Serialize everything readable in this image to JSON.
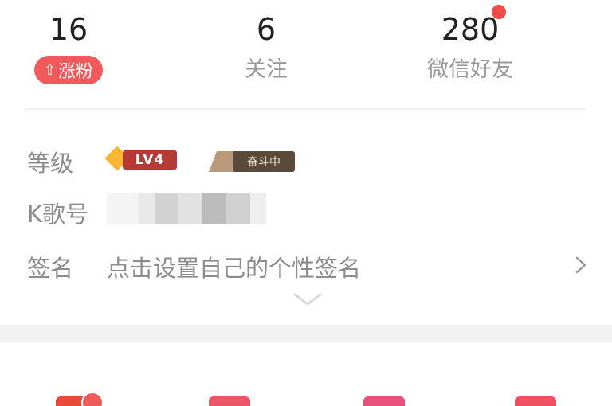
{
  "stats": {
    "fans": {
      "count": "16",
      "button_label": "涨粉",
      "button_icon": "up-arrow-icon"
    },
    "follow": {
      "count": "6",
      "label": "关注"
    },
    "wechat_friends": {
      "count": "280",
      "label": "微信好友",
      "has_notification_dot": true
    }
  },
  "profile": {
    "level_label": "等级",
    "level_badge_text": "LV4",
    "rank_badge_text": "奋斗中",
    "kid_label": "K歌号",
    "signature_label": "签名",
    "signature_placeholder": "点击设置自己的个性签名"
  },
  "colors": {
    "accent_red": "#f2595b",
    "level_badge": "#b63b37",
    "rank_badge": "#5a4a3a",
    "muted_text": "#8c8c8c"
  },
  "menu": {
    "icons": [
      "menu-icon-1",
      "menu-icon-2",
      "menu-icon-3",
      "menu-icon-4"
    ]
  }
}
